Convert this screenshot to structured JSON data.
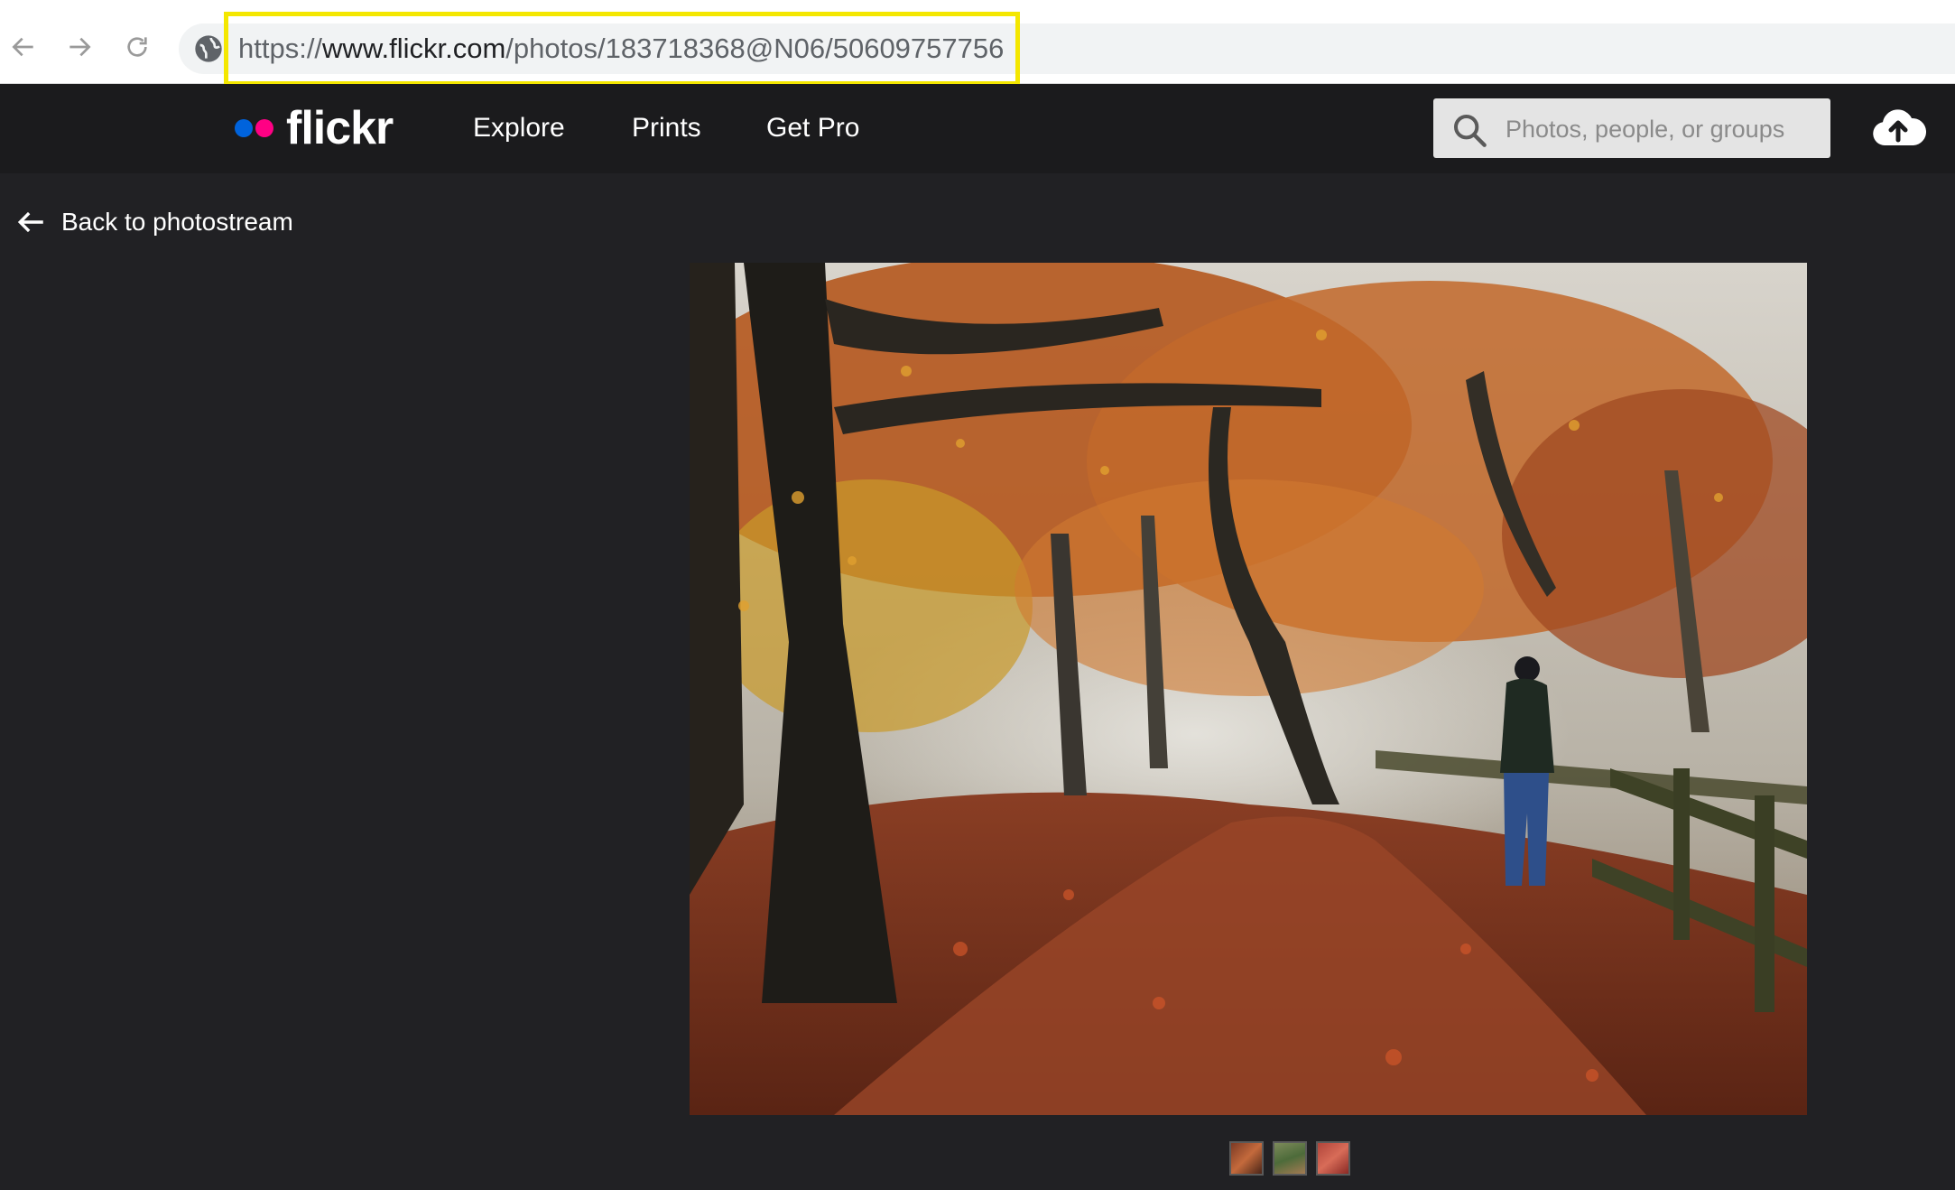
{
  "browser": {
    "url_prefix": "https://",
    "url_host": "www.flickr.com",
    "url_path": "/photos/183718368@N06/50609757756"
  },
  "header": {
    "logo_text": "flickr",
    "nav": [
      "Explore",
      "Prints",
      "Get Pro"
    ],
    "search_placeholder": "Photos, people, or groups"
  },
  "page": {
    "back_label": "Back to photostream"
  },
  "colors": {
    "accent_blue": "#0063dc",
    "accent_pink": "#ff0084",
    "url_highlight": "#f4e700",
    "page_bg": "#212124"
  },
  "icons": [
    "back-arrow-icon",
    "forward-arrow-icon",
    "reload-icon",
    "globe-icon",
    "search-icon",
    "upload-cloud-icon",
    "left-arrow-icon"
  ]
}
